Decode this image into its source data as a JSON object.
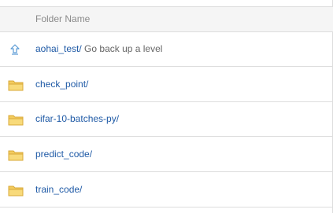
{
  "table": {
    "header": {
      "folder_name": "Folder Name"
    },
    "parent": {
      "name": "aohai_test/",
      "hint": " Go back up a level",
      "icon": "arrow-up-icon"
    },
    "folders": [
      {
        "name": "check_point/",
        "icon": "folder-icon"
      },
      {
        "name": "cifar-10-batches-py/",
        "icon": "folder-icon"
      },
      {
        "name": "predict_code/",
        "icon": "folder-icon"
      },
      {
        "name": "train_code/",
        "icon": "folder-icon"
      }
    ]
  },
  "colors": {
    "link": "#1f5aa6",
    "header_bg": "#f5f5f5",
    "border": "#dddddd",
    "folder": "#f3cc5e",
    "arrow": "#5b9bd5"
  }
}
